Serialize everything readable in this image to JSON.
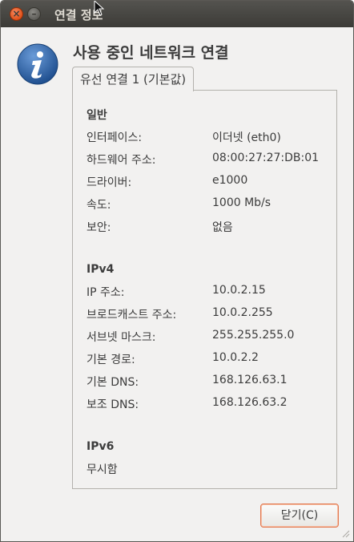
{
  "window": {
    "title": "연결 정보"
  },
  "icons": {
    "close": "close-icon",
    "minimize": "minimize-icon",
    "info": "info-icon",
    "cursor": "mouse-cursor-icon"
  },
  "heading": "사용 중인 네트워크 연결",
  "tab": {
    "label": "유선 연결 1 (기본값)"
  },
  "sections": {
    "general": {
      "title": "일반",
      "rows": [
        {
          "label": "인터페이스:",
          "value": "이더넷 (eth0)"
        },
        {
          "label": "하드웨어 주소:",
          "value": "08:00:27:27:DB:01"
        },
        {
          "label": "드라이버:",
          "value": "e1000"
        },
        {
          "label": "속도:",
          "value": "1000 Mb/s"
        },
        {
          "label": "보안:",
          "value": "없음"
        }
      ]
    },
    "ipv4": {
      "title": "IPv4",
      "rows": [
        {
          "label": "IP 주소:",
          "value": "10.0.2.15"
        },
        {
          "label": "브로드캐스트 주소:",
          "value": "10.0.2.255"
        },
        {
          "label": "서브넷 마스크:",
          "value": "255.255.255.0"
        },
        {
          "label": "기본 경로:",
          "value": "10.0.2.2"
        },
        {
          "label": "기본 DNS:",
          "value": "168.126.63.1"
        },
        {
          "label": "보조 DNS:",
          "value": "168.126.63.2"
        }
      ]
    },
    "ipv6": {
      "title": "IPv6",
      "rows": [
        {
          "label": "무시함"
        }
      ]
    }
  },
  "buttons": {
    "close": "닫기(C)"
  },
  "colors": {
    "titlebar": "#3c3b37",
    "close_button": "#e0511a",
    "focus_border": "#e2774d",
    "info_icon": "#2f5f9a"
  }
}
